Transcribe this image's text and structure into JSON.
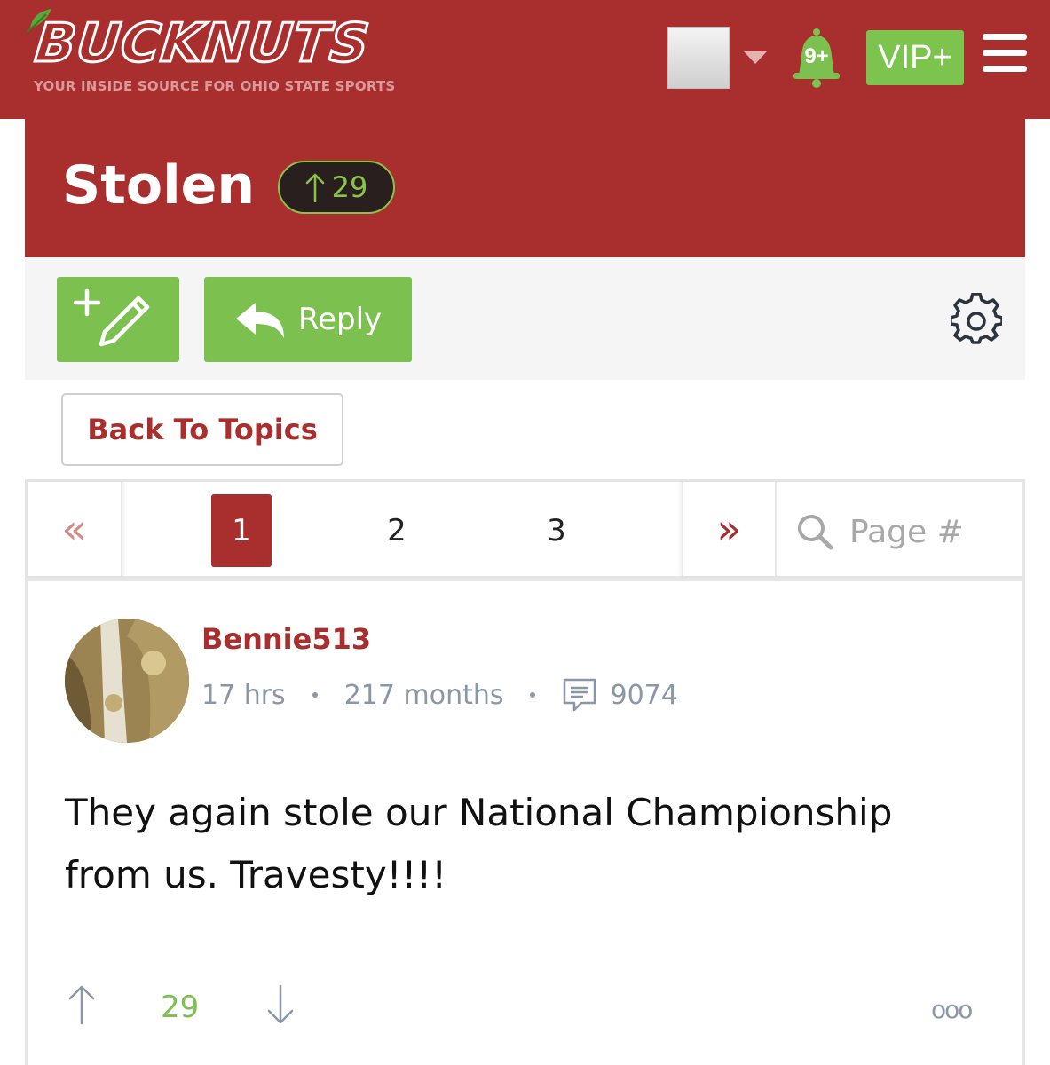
{
  "header": {
    "logo_text": "BUCKNUTS",
    "tagline": "YOUR INSIDE SOURCE FOR OHIO STATE SPORTS",
    "notification_count": "9+",
    "vip_label": "VIP+",
    "colors": {
      "brand_red": "#a92e2e",
      "accent_green": "#7cc050"
    }
  },
  "topic": {
    "title": "Stolen",
    "score": "29"
  },
  "actions": {
    "new_topic_icon": "new-post-pencil-icon",
    "reply_label": "Reply",
    "settings_icon": "gear-icon"
  },
  "back_label": "Back To Topics",
  "pagination": {
    "prev_glyph": "«",
    "next_glyph": "»",
    "pages": [
      "1",
      "2",
      "3"
    ],
    "current": "1",
    "search_placeholder": "Page #"
  },
  "post": {
    "username": "Bennie513",
    "age": "17 hrs",
    "membership": "217 months",
    "post_count": "9074",
    "body": "They again stole our National Championship from us. Travesty!!!!",
    "votes": "29",
    "more_glyph": "ooo"
  }
}
